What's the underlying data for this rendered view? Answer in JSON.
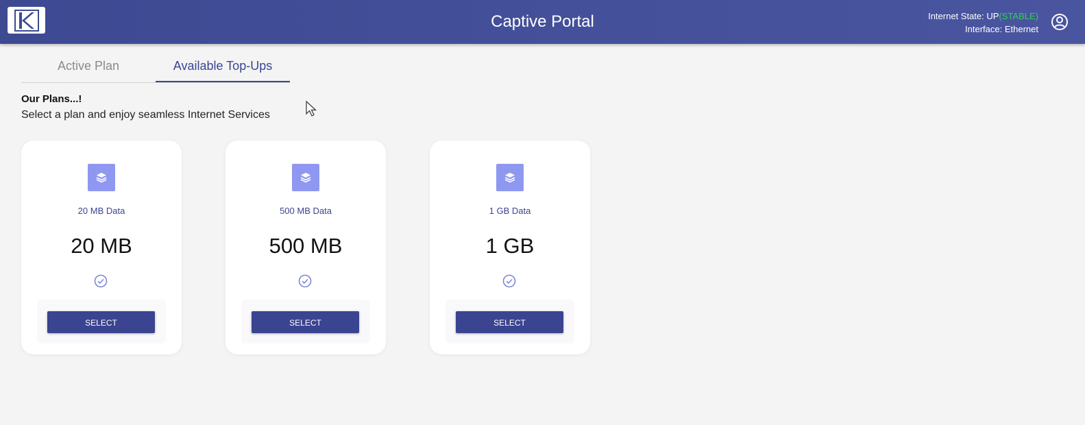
{
  "header": {
    "title": "Captive Portal",
    "logo_icon": "k-logo-icon",
    "profile_icon": "user-circle-icon",
    "internet_state_label": "Internet State:",
    "internet_state_value": "UP",
    "internet_state_quality": "(STABLE)",
    "interface_label": "Interface:",
    "interface_value": "Ethernet",
    "colors": {
      "bar": "#3d4a92",
      "stable": "#2fcf5a"
    }
  },
  "tabs": [
    {
      "label": "Active Plan",
      "active": false
    },
    {
      "label": "Available Top-Ups",
      "active": true
    }
  ],
  "intro": {
    "title": "Our Plans...!",
    "subtitle": "Select a plan and enjoy seamless Internet Services"
  },
  "plans": [
    {
      "name": "20 MB Data",
      "size": "20 MB",
      "button": "SELECT",
      "icon": "database-icon",
      "check_icon": "check-circle-icon"
    },
    {
      "name": "500 MB Data",
      "size": "500 MB",
      "button": "SELECT",
      "icon": "database-icon",
      "check_icon": "check-circle-icon"
    },
    {
      "name": "1 GB Data",
      "size": "1 GB",
      "button": "SELECT",
      "icon": "database-icon",
      "check_icon": "check-circle-icon"
    }
  ],
  "accent_color": "#3b4490"
}
